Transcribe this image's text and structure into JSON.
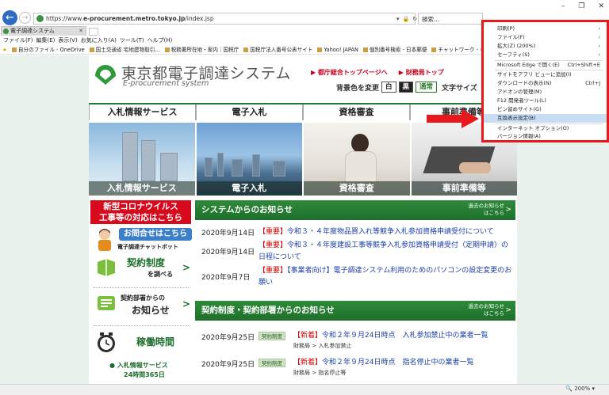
{
  "browser": {
    "url_prefix": "https://www.",
    "url_domain": "e-procurement.metro.tokyo.jp",
    "url_path": "/index.jsp",
    "search_placeholder": "検索...",
    "tab_title": "電子調達システム",
    "menu": [
      "ファイル(F)",
      "編集(E)",
      "表示(V)",
      "お気に入り(A)",
      "ツール(T)",
      "ヘルプ(H)"
    ],
    "favorites": [
      "自分のファイル - OneDrive",
      "国土交通省 宅地建物取引...",
      "税務署所在地・案内｜国税庁",
      "国税庁法人番号公表サイト",
      "Yahoo! JAPAN",
      "個別番号検索 - 日本郵便",
      "チャットワーク - Ｃｏ－Ｌａｂｏ"
    ],
    "zoom": "200%"
  },
  "tools_menu": {
    "items": [
      {
        "label": "印刷(P)",
        "shortcut": "",
        "submenu": true
      },
      {
        "label": "ファイル(F)",
        "shortcut": "",
        "submenu": true
      },
      {
        "label": "拡大(Z) (200%)",
        "shortcut": "",
        "submenu": true
      },
      {
        "label": "セーフティ(S)",
        "shortcut": "",
        "submenu": true
      },
      {
        "label": "Microsoft Edge で開く(E)",
        "shortcut": "Ctrl+Shift+E",
        "submenu": false
      },
      {
        "label": "サイトをアプリ ビューに追加(I)",
        "shortcut": "",
        "submenu": false
      },
      {
        "label": "ダウンロードの表示(N)",
        "shortcut": "Ctrl+J",
        "submenu": false
      },
      {
        "label": "アドオンの管理(M)",
        "shortcut": "",
        "submenu": false
      },
      {
        "label": "F12 開発者ツール(L)",
        "shortcut": "",
        "submenu": false
      },
      {
        "label": "ピン留めサイト(G)",
        "shortcut": "",
        "submenu": false
      },
      {
        "label": "互換表示設定(B)",
        "shortcut": "",
        "submenu": false,
        "highlighted": true
      },
      {
        "label": "インターネット オプション(O)",
        "shortcut": "",
        "submenu": false
      },
      {
        "label": "バージョン情報(A)",
        "shortcut": "",
        "submenu": false
      }
    ]
  },
  "site": {
    "logo_ja": "東京都電子調達システム",
    "logo_en": "E-procurement system",
    "top_link_1": "▶ 都庁総合トップページへ",
    "top_link_2": "▶ 財務局トップ",
    "bgcolor_label": "背景色を変更",
    "color_white": "白",
    "color_black": "黒",
    "color_normal": "通常",
    "fontsize_label": "文字サイズ",
    "nav": [
      "入札情報サービス",
      "電子入札",
      "資格審査",
      "事前準備等"
    ],
    "photos": [
      "入札情報サービス",
      "電子入札",
      "資格審査",
      "事前準備等"
    ],
    "corona_1": "新型コロナウイルス",
    "corona_2": "工事等の対応はこちら",
    "contact": "お問合せはこちら",
    "chatbot": "電子調達チャットボット",
    "contract_1": "契約制度",
    "contract_2": "を調べる",
    "notice_1": "契約部署からの",
    "notice_2": "お知らせ",
    "hours": "稼働時間",
    "hours_svc": "● 入札情報サービス",
    "hours_detail": "24時間365日"
  },
  "news_system": {
    "title": "システムからのお知らせ",
    "past_1": "過去のお知らせ",
    "past_2": "はこちら",
    "items": [
      {
        "date": "2020年9月14日",
        "tag": "【重要】",
        "text": "令和３・４年度物品買入れ等競争入札参加資格申請受付について"
      },
      {
        "date": "2020年9月14日",
        "tag": "【重要】",
        "text": "令和３・４年度建設工事等競争入札参加資格申請受付（定期申請）の日程について"
      },
      {
        "date": "2020年9月7日",
        "tag": "【重要】",
        "text": "【事業者向け】電子調達システム利用のためのパソコンの設定変更のお願い"
      }
    ]
  },
  "news_contract": {
    "title": "契約制度・契約部署からのお知らせ",
    "past_1": "過去のお知らせ",
    "past_2": "はこちら",
    "items": [
      {
        "date": "2020年9月25日",
        "category": "契約制度",
        "tag": "【新着】",
        "text": "令和２年９月24日時点　入札参加禁止中の業者一覧",
        "sub": "財務局 > 入札参加禁止"
      },
      {
        "date": "2020年9月25日",
        "category": "契約制度",
        "tag": "【新着】",
        "text": "令和２年９月24日時点　指名停止中の業者一覧",
        "sub": "財務局 > 指名停止等"
      }
    ]
  }
}
